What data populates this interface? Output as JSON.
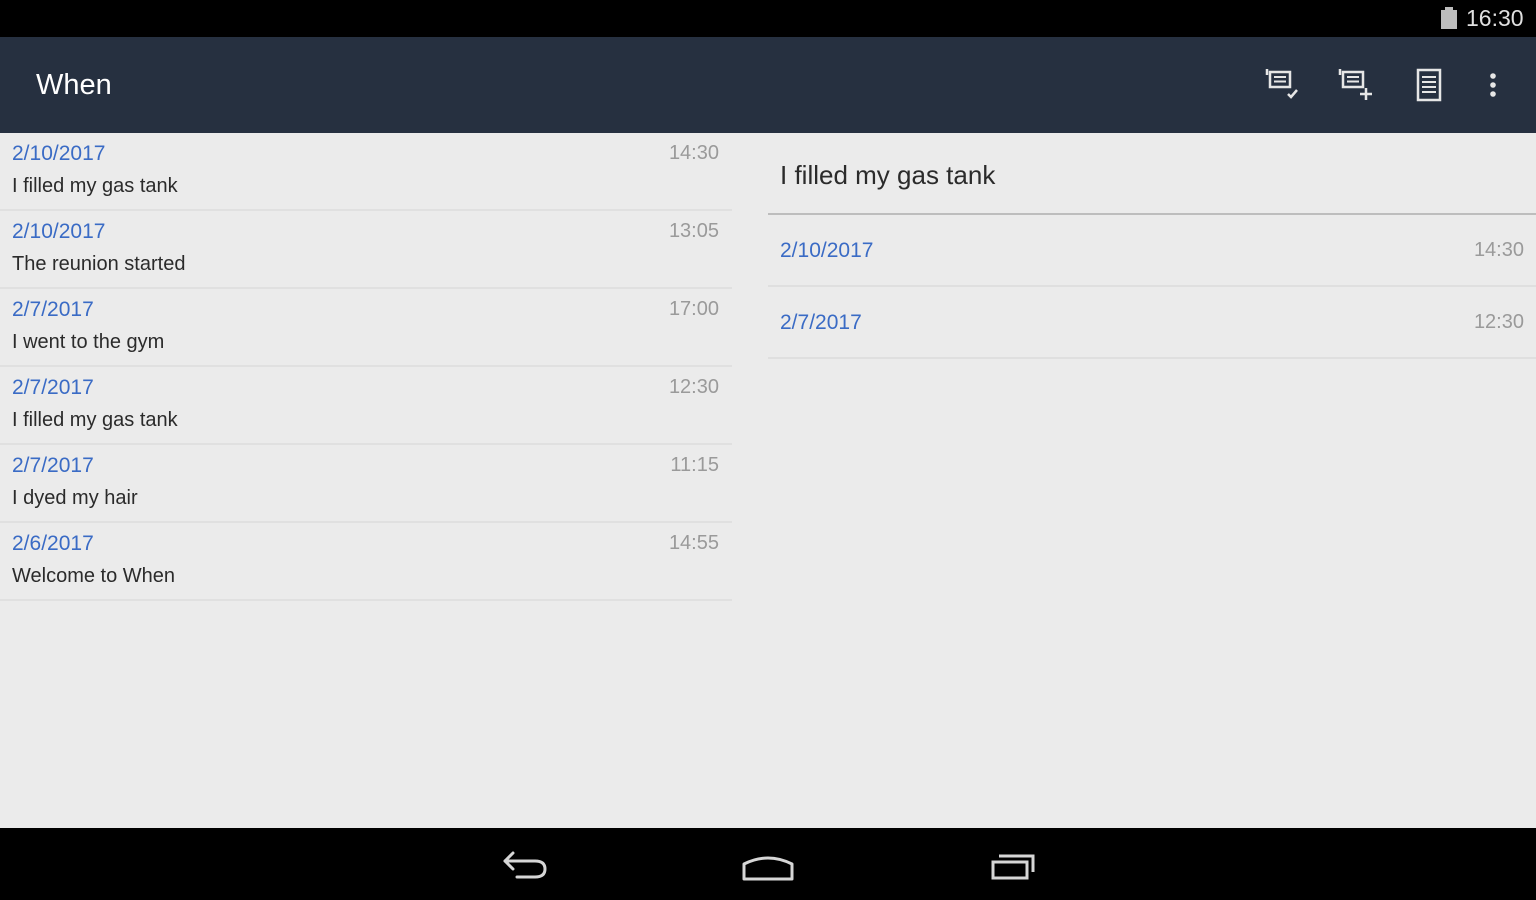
{
  "status_bar": {
    "time": "16:30",
    "battery_icon": "battery-icon"
  },
  "action_bar": {
    "title": "When",
    "actions": [
      {
        "icon": "log-confirm-icon"
      },
      {
        "icon": "log-add-icon"
      },
      {
        "icon": "list-document-icon"
      },
      {
        "icon": "overflow-menu-icon"
      }
    ]
  },
  "entries": [
    {
      "date": "2/10/2017",
      "time": "14:30",
      "text": "I filled my gas tank"
    },
    {
      "date": "2/10/2017",
      "time": "13:05",
      "text": "The reunion started"
    },
    {
      "date": "2/7/2017",
      "time": "17:00",
      "text": "I went to the gym"
    },
    {
      "date": "2/7/2017",
      "time": "12:30",
      "text": "I filled my gas tank"
    },
    {
      "date": "2/7/2017",
      "time": "11:15",
      "text": "I dyed my hair"
    },
    {
      "date": "2/6/2017",
      "time": "14:55",
      "text": "Welcome to When"
    }
  ],
  "detail": {
    "title": "I filled my gas tank",
    "occurrences": [
      {
        "date": "2/10/2017",
        "time": "14:30"
      },
      {
        "date": "2/7/2017",
        "time": "12:30"
      }
    ]
  },
  "nav_bar": {
    "buttons": [
      "back-icon",
      "home-icon",
      "recents-icon"
    ]
  },
  "colors": {
    "action_bar": "#263040",
    "background": "#ebebeb",
    "date_accent": "#3a6bc5",
    "time_text": "#9a9a9a",
    "body_text": "#2b2b2b"
  }
}
